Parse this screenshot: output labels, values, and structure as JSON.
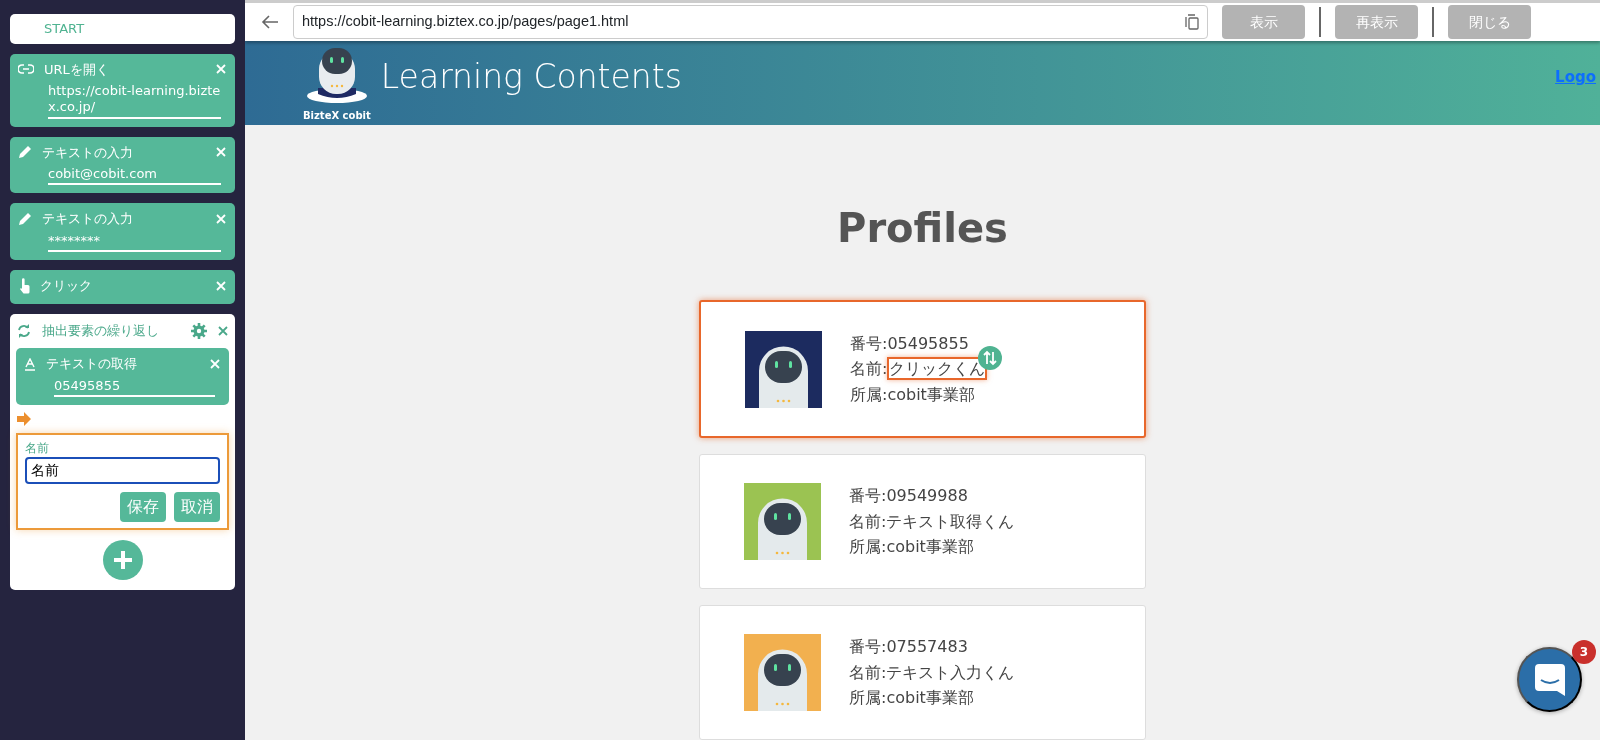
{
  "flow": {
    "start": "START",
    "steps": [
      {
        "kind": "open-url",
        "title": "URLを開く",
        "value": "https://cobit-learning.biztex.co.jp/"
      },
      {
        "kind": "input",
        "title": "テキストの入力",
        "value": "cobit@cobit.com"
      },
      {
        "kind": "input",
        "title": "テキストの入力",
        "value": "********"
      },
      {
        "kind": "click",
        "title": "クリック"
      },
      {
        "kind": "loop",
        "title": "抽出要素の繰り返し",
        "children": [
          {
            "kind": "get-text",
            "title": "テキストの取得",
            "value": "05495855"
          }
        ],
        "editor": {
          "label": "名前",
          "value": "名前",
          "buttons": [
            "保存",
            "取消"
          ]
        }
      }
    ]
  },
  "browser": {
    "url": "https://cobit-learning.biztex.co.jp/pages/page1.html",
    "buttons": [
      "表示",
      "再表示",
      "閉じる"
    ]
  },
  "site": {
    "brand": "BizteX cobit",
    "title": "Learning Contents",
    "nav": "Logo",
    "heading": "Profiles",
    "profiles": [
      {
        "number": "番号:05495855",
        "name_label": "名前:",
        "name": "クリックくん",
        "dept": "所属:cobit事業部",
        "color": "#1c2b5f",
        "selected": true
      },
      {
        "number": "番号:09549988",
        "name_label": "名前:",
        "name": "テキスト取得くん",
        "dept": "所属:cobit事業部",
        "color": "#9bc352",
        "selected": false
      },
      {
        "number": "番号:07557483",
        "name_label": "名前:",
        "name": "テキスト入力くん",
        "dept": "所属:cobit事業部",
        "color": "#f2b04f",
        "selected": false
      }
    ]
  },
  "chat": {
    "badge": "3"
  }
}
